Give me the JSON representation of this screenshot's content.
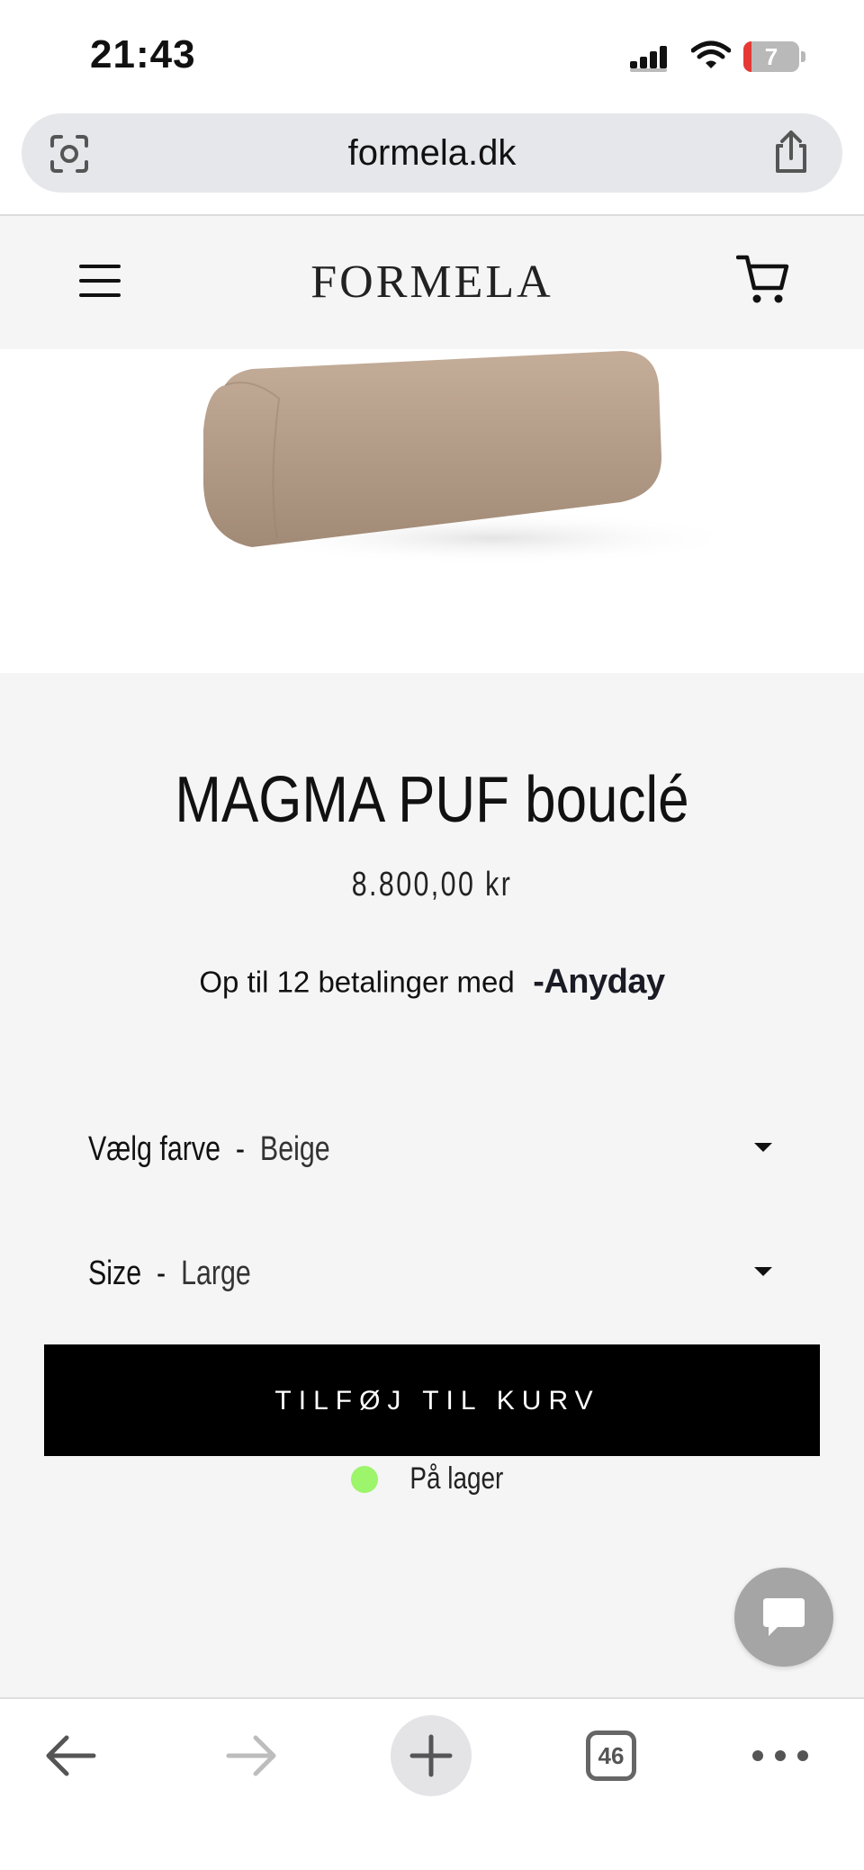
{
  "status_bar": {
    "time": "21:43",
    "battery_level": "7",
    "icons": [
      "signal-icon",
      "wifi-icon",
      "battery-icon"
    ]
  },
  "browser": {
    "url": "formela.dk",
    "icons": [
      "visual-search-icon",
      "share-icon"
    ]
  },
  "site_header": {
    "logo": "FORMELA",
    "icons": [
      "menu-icon",
      "cart-icon"
    ]
  },
  "product": {
    "title": "MAGMA PUF bouclé",
    "price": "8.800,00 kr",
    "installments_text": "Op til 12 betalinger med",
    "installments_brand": "-Anyday",
    "options": [
      {
        "label": "Vælg farve",
        "separator": "-",
        "value": "Beige"
      },
      {
        "label": "Size",
        "separator": "-",
        "value": "Large"
      }
    ],
    "add_to_cart": "TILFØJ TIL KURV",
    "stock_status": "På lager",
    "stock_color": "#9cf56a"
  },
  "toolbar": {
    "tab_count": "46",
    "icons": [
      "back-icon",
      "forward-icon",
      "new-tab-icon",
      "tabs-icon",
      "more-icon"
    ]
  },
  "colors": {
    "accent_button": "#000000",
    "page_background": "#f5f5f5",
    "chat_button": "#a5a5a5"
  }
}
